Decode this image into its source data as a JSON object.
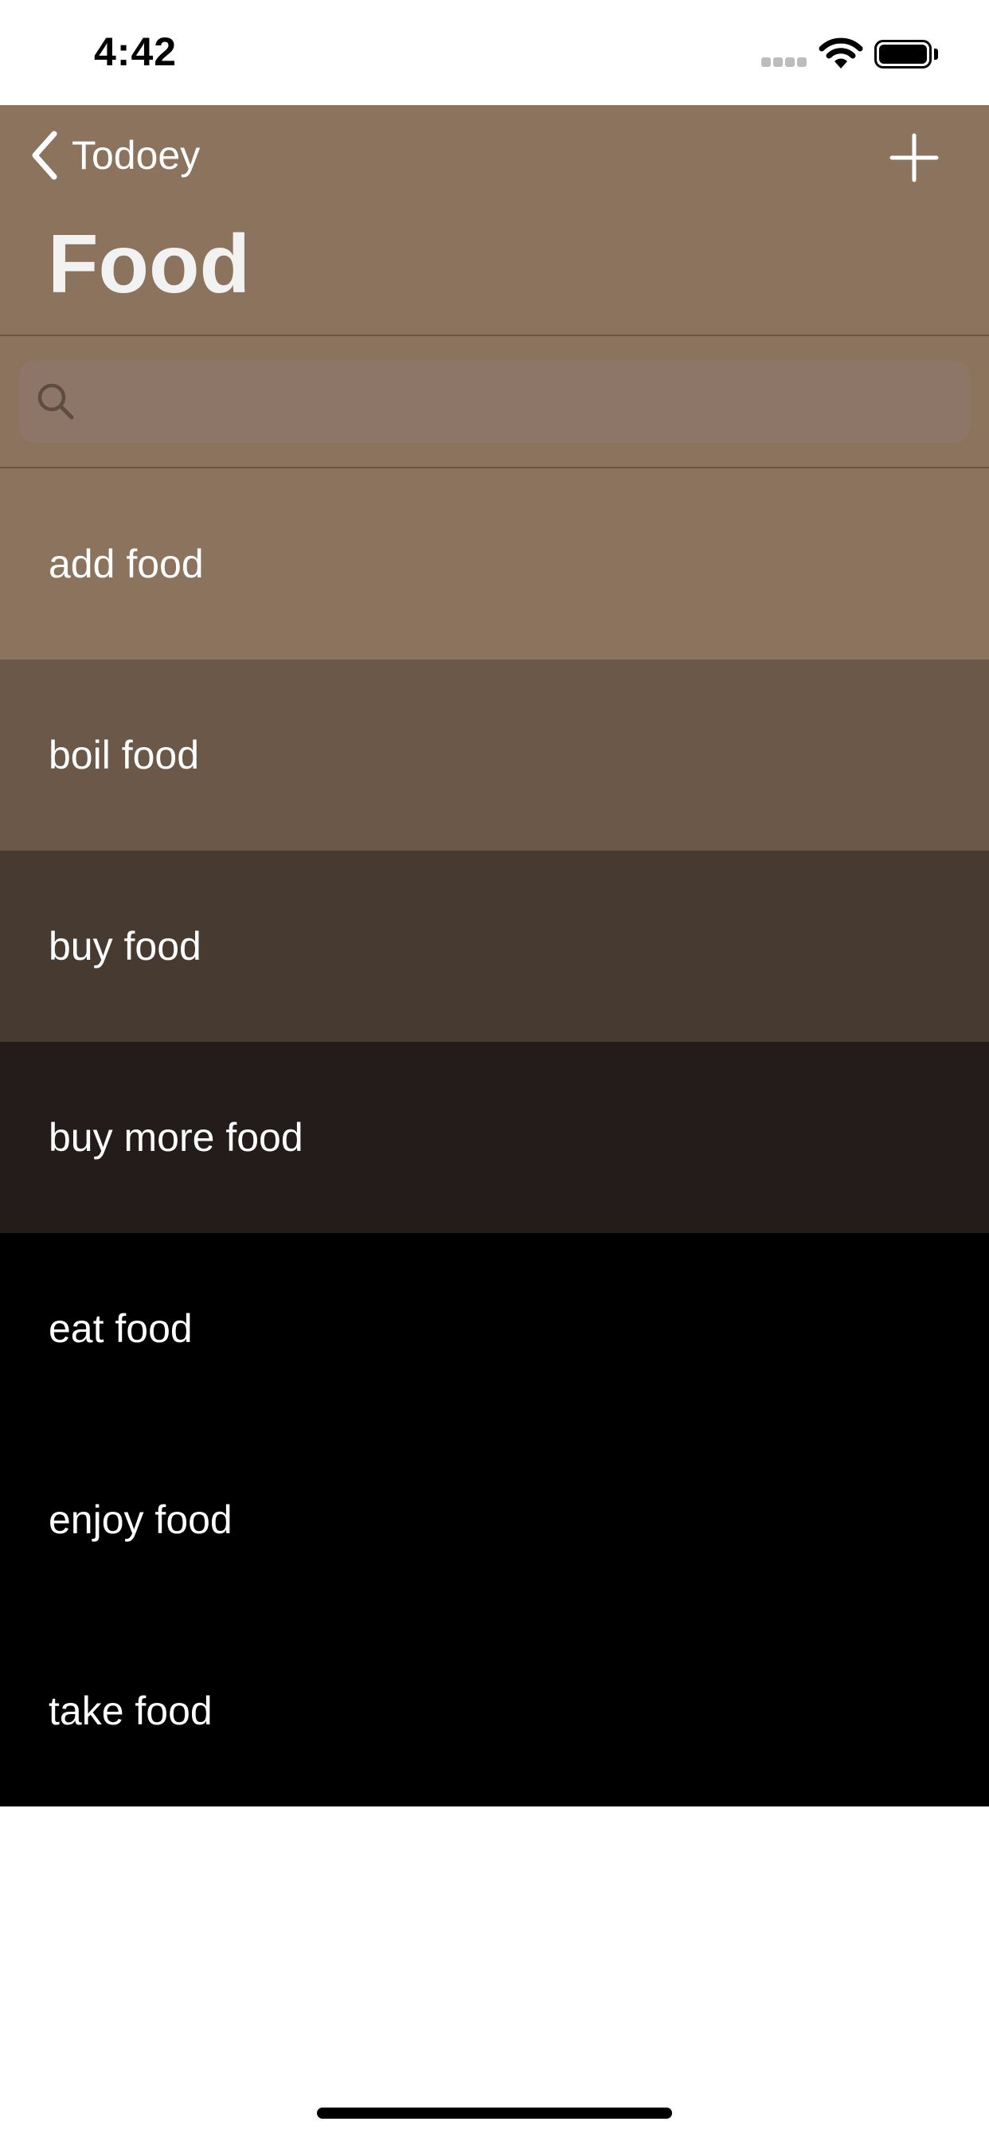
{
  "status_bar": {
    "time": "4:42",
    "icons": [
      "signal-icon",
      "wifi-icon",
      "battery-icon"
    ]
  },
  "nav": {
    "back_label": "Todoey",
    "title": "Food",
    "icons": {
      "back": "chevron-left-icon",
      "add": "plus-icon"
    }
  },
  "search": {
    "value": "",
    "placeholder": "",
    "icon": "search-icon"
  },
  "items": [
    {
      "label": "add food",
      "color": "#8c735e"
    },
    {
      "label": "boil food",
      "color": "#6b5849"
    },
    {
      "label": "buy food",
      "color": "#473a31"
    },
    {
      "label": "buy more food",
      "color": "#241c1a"
    },
    {
      "label": "eat food",
      "color": "#000000"
    },
    {
      "label": "enjoy food",
      "color": "#000000"
    },
    {
      "label": "take food",
      "color": "#000000"
    }
  ],
  "theme": {
    "nav_background": "#8c735e",
    "search_background": "#8d7668",
    "divider": "#6a5545",
    "text": "#ffffff"
  }
}
